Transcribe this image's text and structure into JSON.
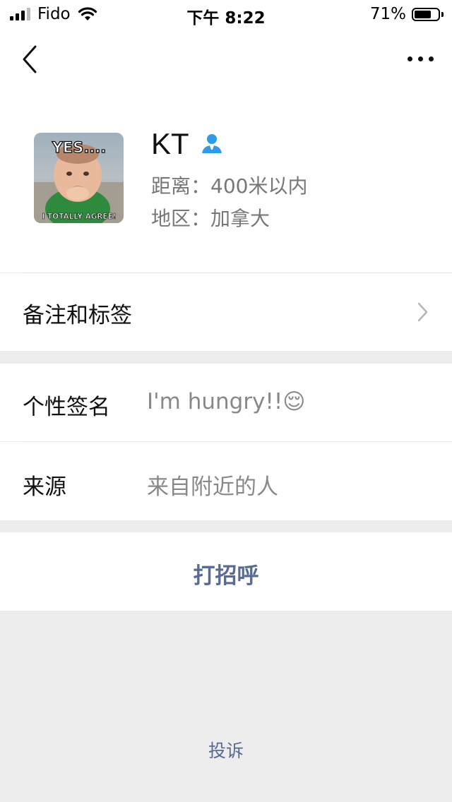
{
  "status_bar": {
    "carrier": "Fido",
    "time": "下午 8:22",
    "battery_percent": "71%",
    "battery_level": 0.71,
    "signal_bars": 3,
    "icons": [
      "signal-icon",
      "wifi-icon",
      "battery-icon"
    ]
  },
  "nav": {
    "back_icon": "chevron-left-icon",
    "more_icon": "more-icon"
  },
  "profile": {
    "name": "KT",
    "avatar_caption_top": "YES....",
    "avatar_caption_bottom": "I TOTALLY AGREE!",
    "gender_icon": "person-icon",
    "distance": "距离：400米以内",
    "region": "地区：加拿大"
  },
  "rows": {
    "remark_tags": "备注和标签",
    "signature_label": "个性签名",
    "signature_value": "I'm hungry!!😌",
    "source_label": "来源",
    "source_value": "来自附近的人"
  },
  "actions": {
    "greet": "打招呼",
    "complain": "投诉"
  },
  "colors": {
    "link_blue": "#576b95",
    "gender_blue": "#2d9bea",
    "background_gray": "#ededed"
  }
}
